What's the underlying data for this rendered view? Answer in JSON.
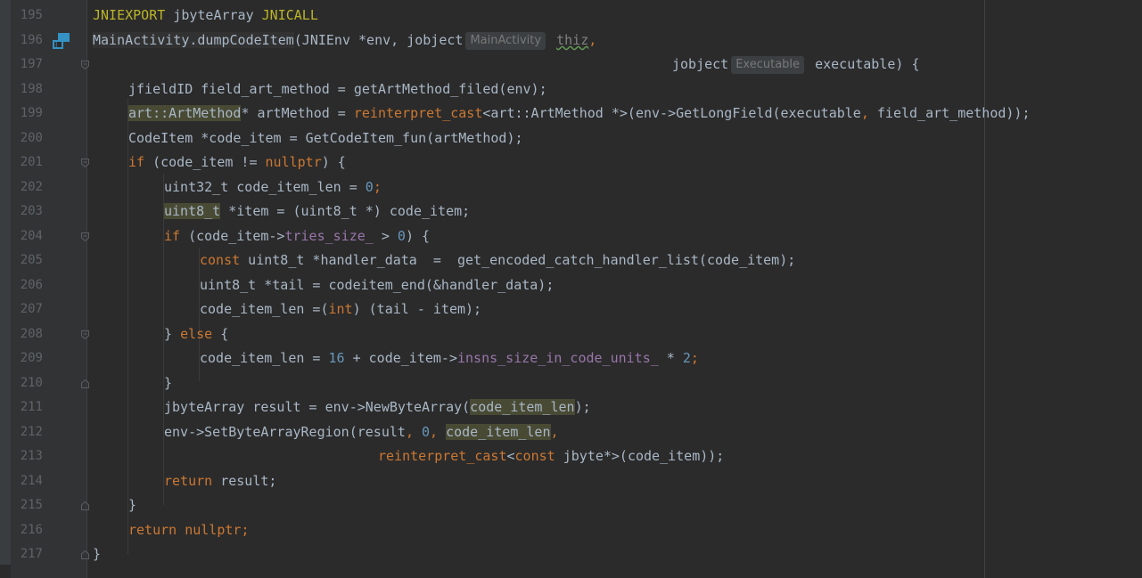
{
  "editor": {
    "param_hints": {
      "env_type": "MainActivity",
      "exec_type": "Executable"
    },
    "lines": [
      {
        "num": "195"
      },
      {
        "num": "196"
      },
      {
        "num": "197"
      },
      {
        "num": "198"
      },
      {
        "num": "199"
      },
      {
        "num": "200"
      },
      {
        "num": "201"
      },
      {
        "num": "202"
      },
      {
        "num": "203"
      },
      {
        "num": "204"
      },
      {
        "num": "205"
      },
      {
        "num": "206"
      },
      {
        "num": "207"
      },
      {
        "num": "208"
      },
      {
        "num": "209"
      },
      {
        "num": "210"
      },
      {
        "num": "211"
      },
      {
        "num": "212"
      },
      {
        "num": "213"
      },
      {
        "num": "214"
      },
      {
        "num": "215"
      },
      {
        "num": "216"
      },
      {
        "num": "217"
      }
    ],
    "tokens": {
      "l195": [
        "JNIEXPORT",
        "jbyteArray",
        "JNICALL"
      ],
      "l196": [
        "MainActivity.dumpCodeItem",
        "(JNIEnv *env, jobject",
        "thiz",
        ","
      ],
      "l197": [
        "jobject",
        "executable) {"
      ],
      "l198": [
        "jfieldID field_art_method = getArtMethod_filed(env);"
      ],
      "l199": [
        "art::ArtMethod",
        "* artMethod = ",
        "reinterpret_cast",
        "<art::ArtMethod *>(env->GetLongField(executable",
        ",",
        " field_art_method));"
      ],
      "l200": [
        "CodeItem *code_item = GetCodeItem_fun(artMethod);"
      ],
      "l201": [
        "if",
        " (code_item != ",
        "nullptr",
        ") {"
      ],
      "l202": [
        "uint32_t code_item_len = ",
        "0",
        ";"
      ],
      "l203": [
        "uint8_t",
        " *item = (uint8_t *) code_item;"
      ],
      "l204": [
        "if",
        " (code_item->",
        "tries_size_",
        " > ",
        "0",
        ") {"
      ],
      "l205": [
        "const",
        " uint8_t *handler_data  =  get_encoded_catch_handler_list(code_item);"
      ],
      "l206": [
        "uint8_t *tail = codeitem_end(&handler_data);"
      ],
      "l207": [
        "code_item_len =(",
        "int",
        ") (tail - item);"
      ],
      "l208": [
        "} ",
        "else",
        " {"
      ],
      "l209": [
        "code_item_len = ",
        "16",
        " + code_item->",
        "insns_size_in_code_units_",
        " * ",
        "2",
        ";"
      ],
      "l210": [
        "}"
      ],
      "l211": [
        "jbyteArray result = env->NewByteArray(",
        "code_item_len",
        ");"
      ],
      "l212": [
        "env->SetByteArrayRegion(result",
        ",",
        " ",
        "0",
        ",",
        " ",
        "code_item_len",
        ","
      ],
      "l213": [
        "reinterpret_cast",
        "<",
        "const",
        " jbyte*>(code_item));"
      ],
      "l214": [
        "return",
        " result;"
      ],
      "l215": [
        "}"
      ],
      "l216": [
        "return",
        " ",
        "nullptr",
        ";"
      ],
      "l217": [
        "}"
      ]
    }
  },
  "colors": {
    "background": "#2b2b2b",
    "gutter": "#313335",
    "keyword": "#cc7832",
    "macro": "#bbb529",
    "number": "#6897bb",
    "field": "#9876aa",
    "text": "#a9b7c6"
  },
  "icons": {
    "impl": "jni-implementation-icon",
    "fold": "fold-marker-icon"
  }
}
